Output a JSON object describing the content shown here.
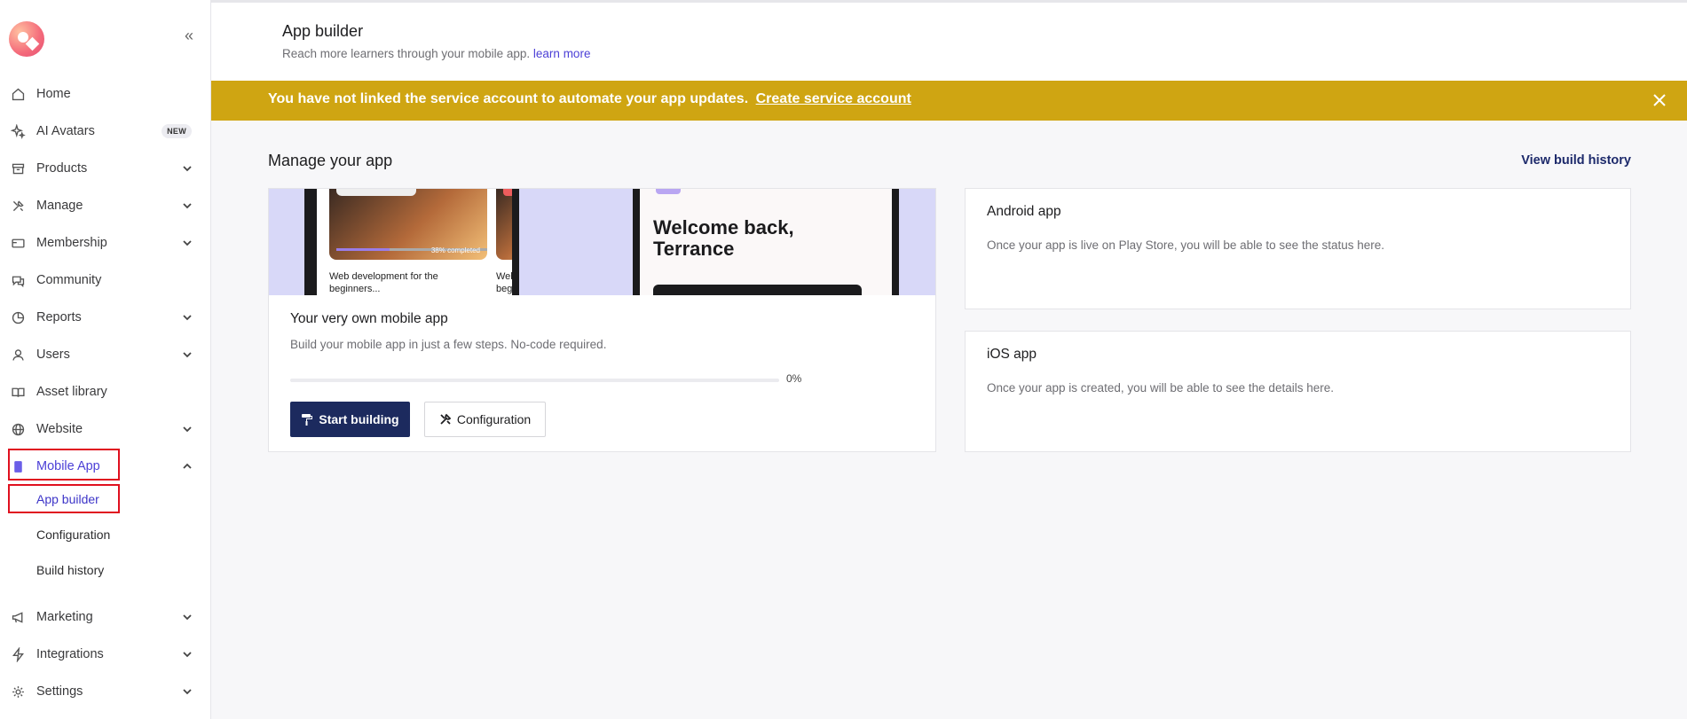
{
  "sidebar": {
    "collapse_glyph": "«",
    "items": [
      {
        "label": "Home",
        "icon": "home-icon"
      },
      {
        "label": "AI Avatars",
        "icon": "sparkle-icon",
        "badge": "NEW"
      },
      {
        "label": "Products",
        "icon": "box-icon"
      },
      {
        "label": "Manage",
        "icon": "tools-icon"
      },
      {
        "label": "Membership",
        "icon": "card-icon"
      },
      {
        "label": "Community",
        "icon": "chat-icon"
      },
      {
        "label": "Reports",
        "icon": "pie-chart-icon"
      },
      {
        "label": "Users",
        "icon": "user-icon"
      },
      {
        "label": "Asset library",
        "icon": "book-icon"
      },
      {
        "label": "Website",
        "icon": "globe-icon"
      },
      {
        "label": "Mobile App",
        "icon": "mobile-icon"
      },
      {
        "label": "Marketing",
        "icon": "megaphone-icon"
      },
      {
        "label": "Integrations",
        "icon": "bolt-icon"
      },
      {
        "label": "Settings",
        "icon": "gear-icon"
      }
    ],
    "mobile_sub": [
      "App builder",
      "Configuration",
      "Build history"
    ]
  },
  "header": {
    "title": "App builder",
    "subtitle": "Reach more learners through your mobile app.",
    "learn_more": "learn more"
  },
  "banner": {
    "text": "You have not linked the service account to automate your app updates.",
    "link": "Create service account",
    "color": "#cfa512"
  },
  "main": {
    "section_title": "Manage your app",
    "view_history": "View build history",
    "app_card": {
      "preview": {
        "course_1": "Web development for the beginners...",
        "course_2": "Web develop beginners...",
        "completed": "38% completed",
        "welcome": "Welcome back, Terrance"
      },
      "title": "Your very own mobile app",
      "desc": "Build your mobile app in just a few steps. No-code required.",
      "progress_label": "0%",
      "progress_value": 0,
      "start_label": "Start building",
      "config_label": "Configuration"
    },
    "android": {
      "title": "Android app",
      "desc": "Once your app is live on Play Store, you will be able to see the status here."
    },
    "ios": {
      "title": "iOS app",
      "desc": "Once your app is created, you will be able to see the details here."
    }
  },
  "colors": {
    "accent": "#4b3fd6",
    "primary_button": "#1c2a5e",
    "highlight_box": "#e0101f"
  }
}
